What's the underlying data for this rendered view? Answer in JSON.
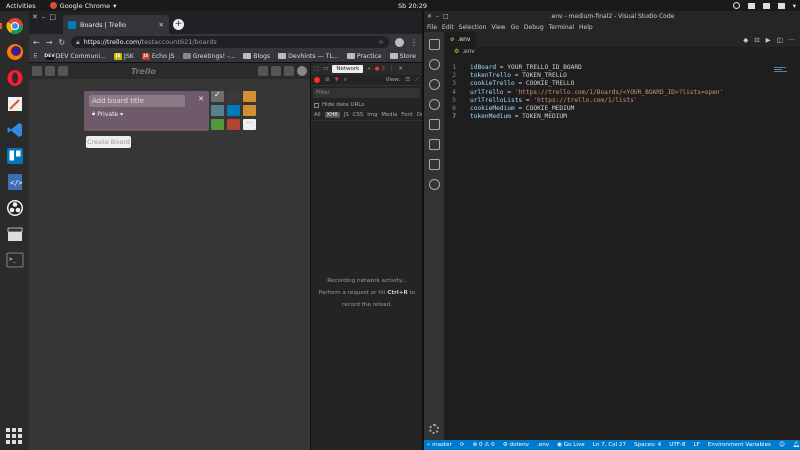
{
  "topbar": {
    "activities": "Activities",
    "app_name": "Google Chrome",
    "clock": "Sb 20:29"
  },
  "dock": {
    "items": [
      "chrome-icon",
      "firefox-icon",
      "opera-icon",
      "text-editor-icon",
      "vscode-icon",
      "trello-icon",
      "code-icon",
      "obs-icon",
      "clapper-icon",
      "terminal-icon"
    ]
  },
  "chrome": {
    "tab_title": "Boards | Trello",
    "url_host": "https://trello.com/",
    "url_path": "testaccount621/boards",
    "bookmarks": [
      {
        "label": "DEV Communi...",
        "icon_text": "DEV",
        "color": "#111111"
      },
      {
        "label": "JSK",
        "icon_text": "JS",
        "color": "#c9b800"
      },
      {
        "label": "Echo JS",
        "icon_text": "JS",
        "color": "#c0392b"
      },
      {
        "label": "Greetings! -...",
        "icon_text": "",
        "color": "#888888"
      },
      {
        "label": "Blogs",
        "icon_text": "",
        "color": "#bbbbbb"
      },
      {
        "label": "Devhints — TL...",
        "icon_text": "",
        "color": "#bbbbbb"
      },
      {
        "label": "Practice",
        "icon_text": "",
        "color": "#bbbbbb"
      },
      {
        "label": "Store",
        "icon_text": "",
        "color": "#bbbbbb"
      }
    ]
  },
  "trello": {
    "logo": "Trello",
    "board_title_placeholder": "Add board title",
    "privacy": "Private",
    "create_button": "Create Board",
    "backgrounds": [
      "#6e6e6e",
      "#3a3a3a",
      "#d29034",
      "#5a7f8f",
      "#0079bf",
      "#d29034",
      "#519839",
      "#b04632",
      "#eeeeee"
    ]
  },
  "devtools": {
    "network_tab": "Network",
    "error_count": "3",
    "view_label": "View:",
    "filter_placeholder": "Filter",
    "hide_data_urls": "Hide data URLs",
    "types": [
      "All",
      "XHR",
      "JS",
      "CSS",
      "Img",
      "Media",
      "Font",
      "Doc",
      "W"
    ],
    "empty_line1": "Recording network activity...",
    "empty_line2_pre": "Perform a request or hit ",
    "empty_line2_key": "Ctrl+R",
    "empty_line2_post": " to",
    "empty_line3": "record the reload."
  },
  "vscode": {
    "title": ".env - medium-final2 - Visual Studio Code",
    "menu": [
      "File",
      "Edit",
      "Selection",
      "View",
      "Go",
      "Debug",
      "Terminal",
      "Help"
    ],
    "tab_label": ".env",
    "breadcrumb": ".env",
    "lines": [
      {
        "n": "1",
        "key": "idBoard",
        "eq": " = ",
        "val": "YOUR_TRELLO_ID_BOARD",
        "str": false
      },
      {
        "n": "2",
        "key": "tokenTrello",
        "eq": " = ",
        "val": "TOKEN_TRELLO",
        "str": false
      },
      {
        "n": "3",
        "key": "cookieTrello",
        "eq": " = ",
        "val": "COOKIE_TRELLO",
        "str": false
      },
      {
        "n": "4",
        "key": "urlTrello",
        "eq": " = ",
        "val": "'https://trello.com/1/Boards/<YOUR_BOARD_ID>?lists=open'",
        "str": true
      },
      {
        "n": "5",
        "key": "urlTrelloLists",
        "eq": " = ",
        "val": "'https://trello.com/1/lists'",
        "str": true
      },
      {
        "n": "6",
        "key": "cookieMedium",
        "eq": " = ",
        "val": "COOKIE_MEDIUM",
        "str": false
      },
      {
        "n": "7",
        "key": "tokenMedium",
        "eq": " = ",
        "val": "TOKEN_MEDIUM",
        "str": false
      }
    ],
    "status": {
      "branch": "master",
      "problems": "⊗ 0 ⚠ 0",
      "language_tag": "dotenv",
      "file": ".env",
      "go_live": "Go Live",
      "cursor": "Ln 7, Col 27",
      "spaces": "Spaces: 4",
      "encoding": "UTF-8",
      "eol": "LF",
      "mode": "Environment Variables"
    }
  }
}
